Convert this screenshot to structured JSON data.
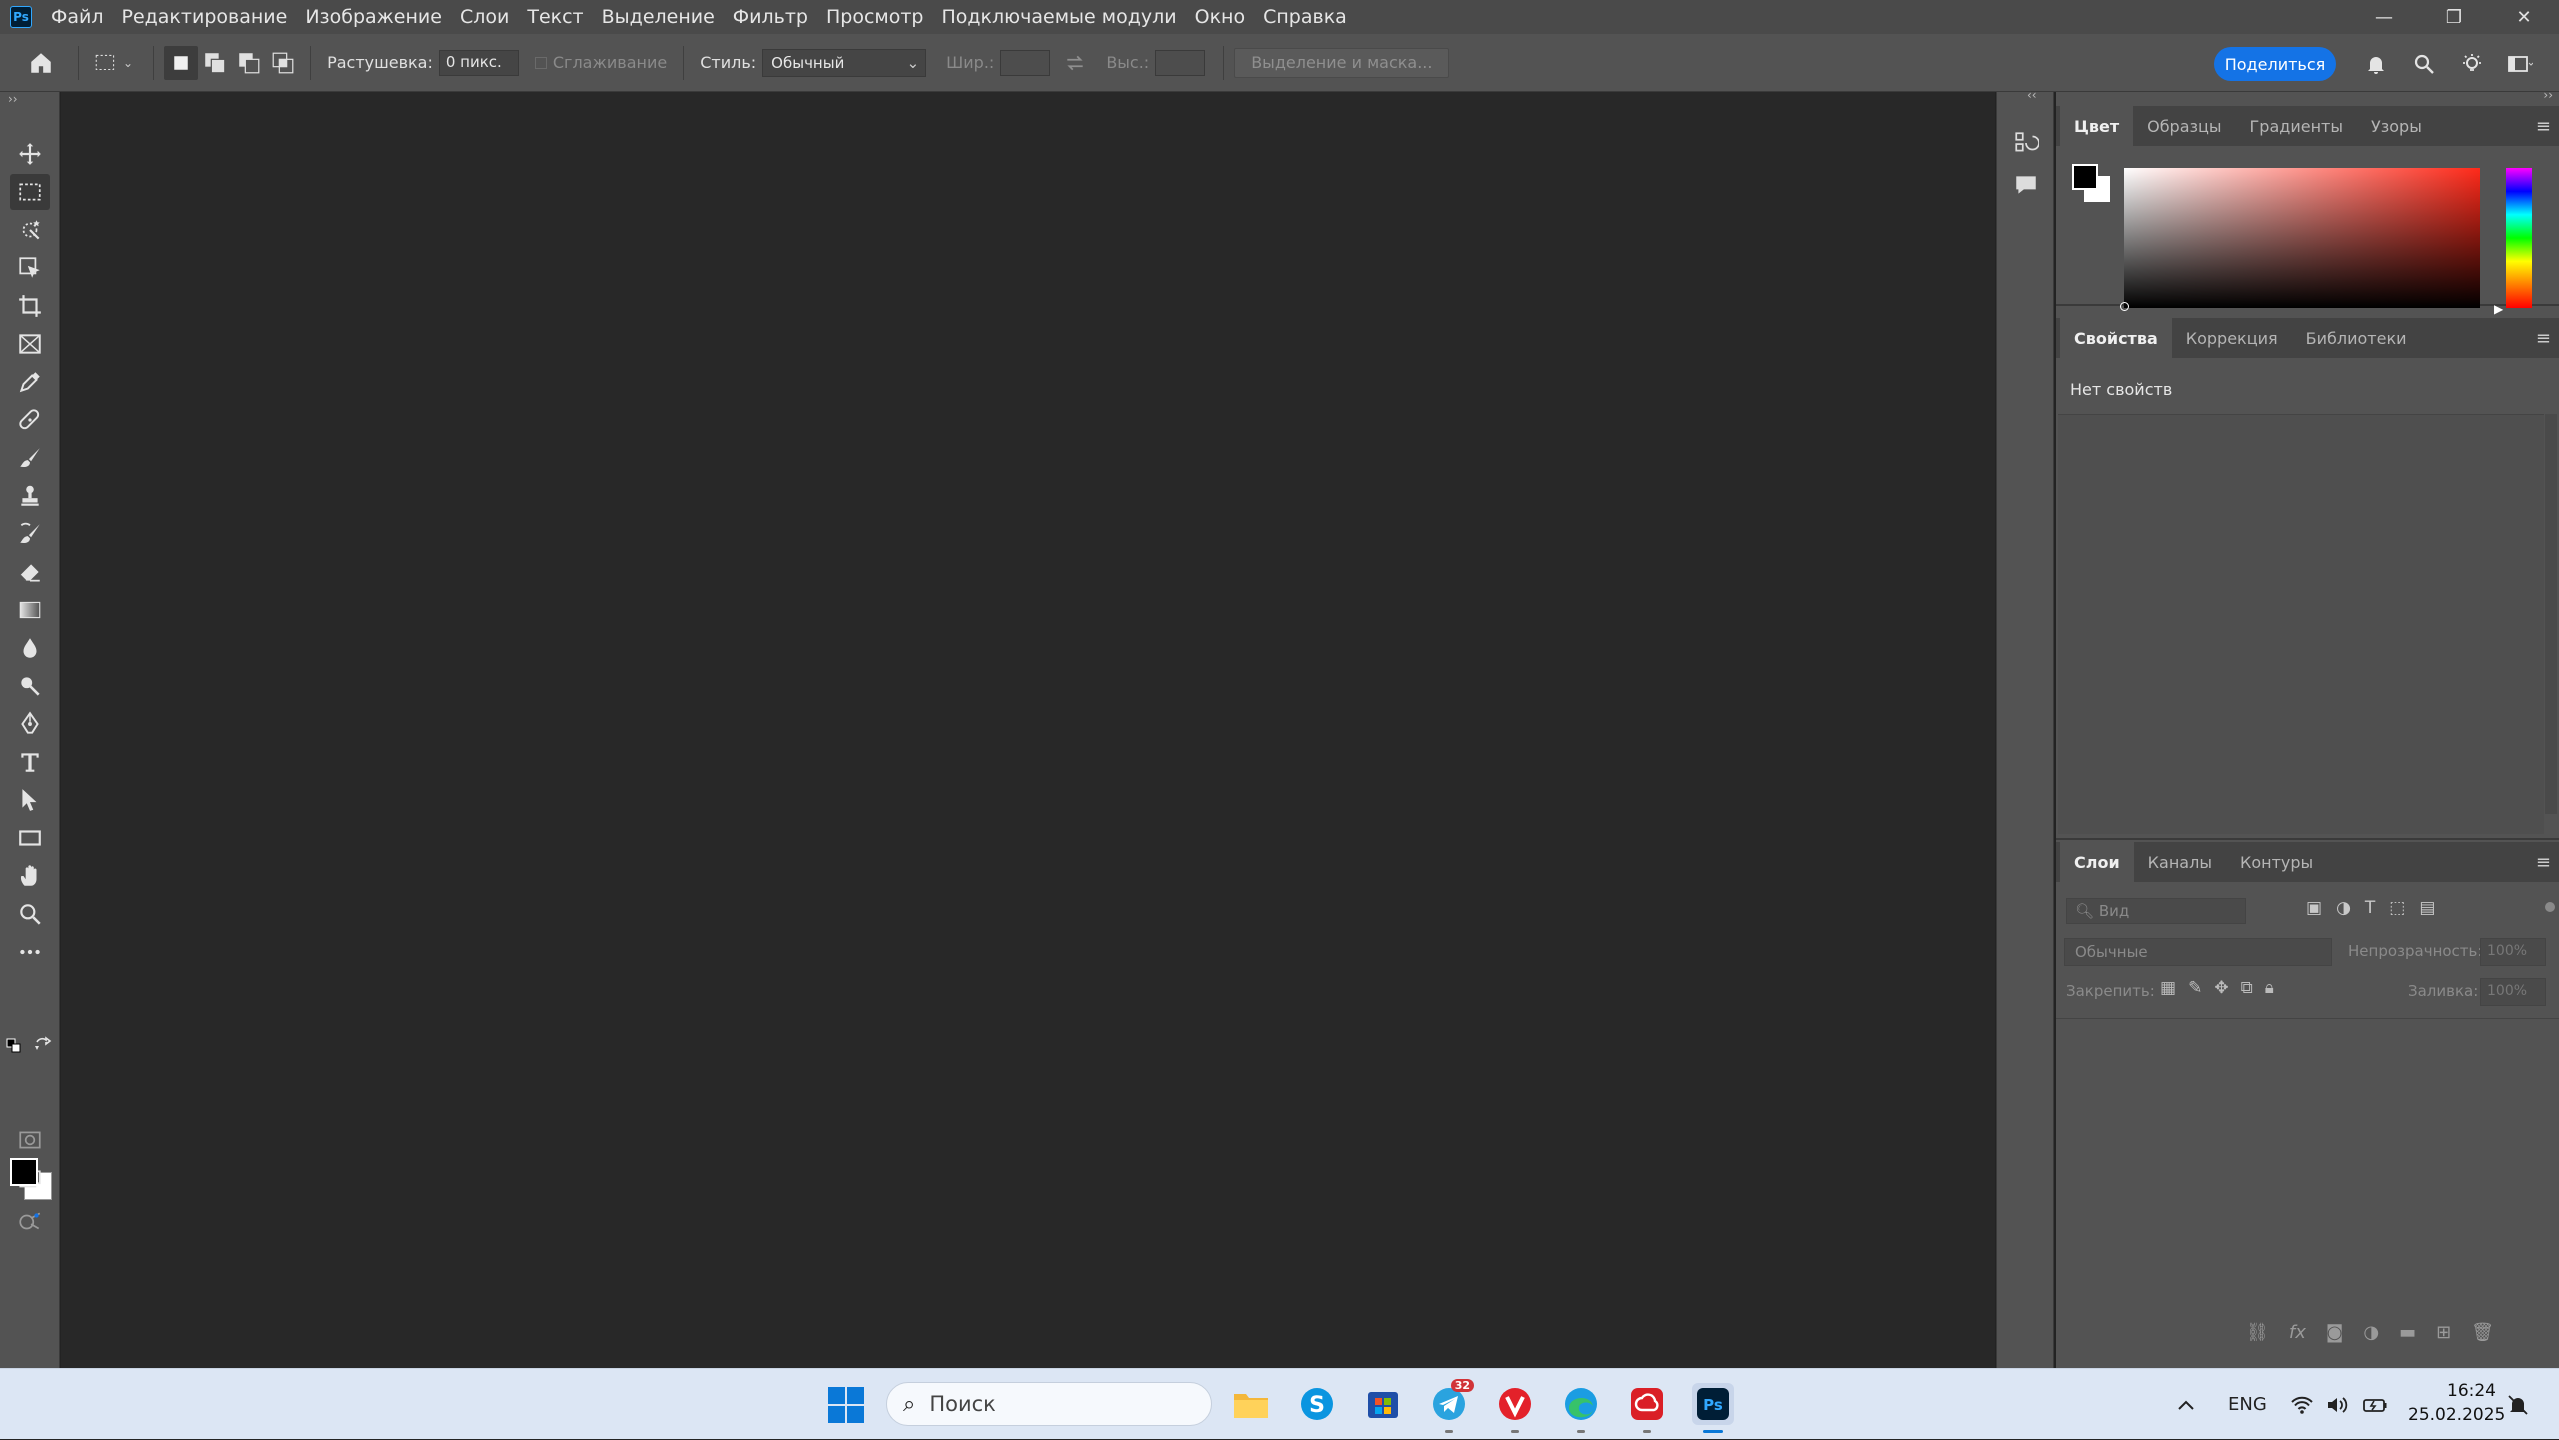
{
  "app": {
    "logo": "Ps",
    "menu": [
      "Файл",
      "Редактирование",
      "Изображение",
      "Слои",
      "Текст",
      "Выделение",
      "Фильтр",
      "Просмотр",
      "Подключаемые модули",
      "Окно",
      "Справка"
    ],
    "window_controls": {
      "minimize": "—",
      "restore": "❐",
      "close": "✕"
    }
  },
  "options": {
    "feather_label": "Растушевка:",
    "feather_value": "0 пикс.",
    "antialias_label": "Сглаживание",
    "style_label": "Стиль:",
    "style_value": "Обычный",
    "width_label": "Шир.:",
    "height_label": "Выс.:",
    "mask_button": "Выделение и маска...",
    "share_button": "Поделиться"
  },
  "color_panel": {
    "tabs": [
      "Цвет",
      "Образцы",
      "Градиенты",
      "Узоры"
    ],
    "active_tab": 0,
    "foreground": "#000000",
    "background": "#ffffff",
    "hue_color": "#ff2a1a"
  },
  "properties_panel": {
    "tabs": [
      "Свойства",
      "Коррекция",
      "Библиотеки"
    ],
    "active_tab": 0,
    "empty_text": "Нет свойств"
  },
  "layers_panel": {
    "tabs": [
      "Слои",
      "Каналы",
      "Контуры"
    ],
    "active_tab": 0,
    "search_placeholder": "Вид",
    "blend_mode": "Обычные",
    "opacity_label": "Непрозрачность:",
    "opacity_value": "100%",
    "lock_label": "Закрепить:",
    "fill_label": "Заливка:",
    "fill_value": "100%"
  },
  "taskbar": {
    "search_placeholder": "Поиск",
    "telegram_badge": "32",
    "language": "ENG",
    "time": "16:24",
    "date": "25.02.2025"
  }
}
